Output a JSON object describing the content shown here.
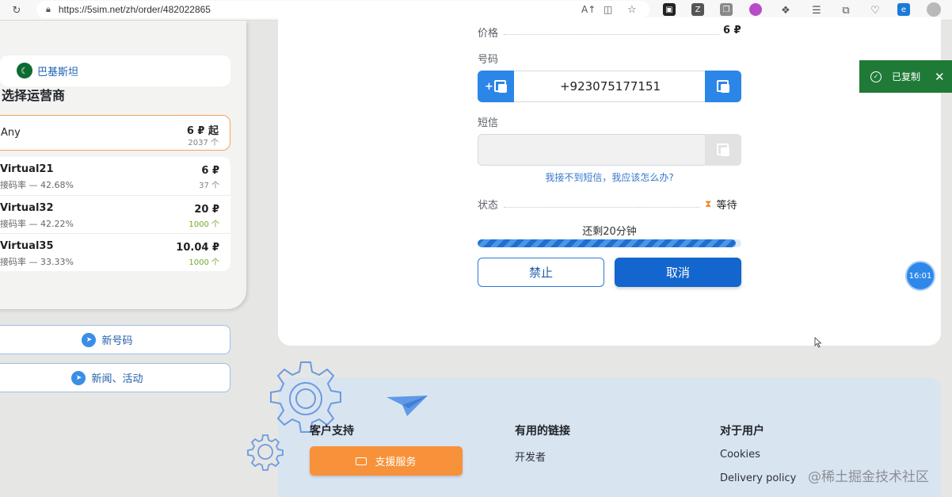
{
  "browser": {
    "url": "https://5sim.net/zh/order/482022865",
    "icons": [
      "refresh-icon",
      "lock-icon",
      "read-aloud-icon",
      "split-screen-icon",
      "favorite-add-icon",
      "favorites-icon",
      "collections-icon",
      "profile-avatar"
    ]
  },
  "sidebar": {
    "country": "巴基斯坦",
    "section_title": "选择运营商",
    "any": {
      "name": "Any",
      "price": "6 ₽ 起",
      "count": "2037 个"
    },
    "operators": [
      {
        "name": "Virtual21",
        "rate": "接码率 — 42.68%",
        "price": "6 ₽",
        "count": "37 个",
        "count_color": "#808080"
      },
      {
        "name": "Virtual32",
        "rate": "接码率 — 42.22%",
        "price": "20 ₽",
        "count": "1000 个",
        "count_color": "#74a82c"
      },
      {
        "name": "Virtual35",
        "rate": "接码率 — 33.33%",
        "price": "10.04 ₽",
        "count": "1000 个",
        "count_color": "#74a82c"
      }
    ],
    "links": {
      "new_number": "新号码",
      "news": "新闻、活动"
    }
  },
  "order": {
    "price_label": "价格",
    "price_value": "6 ₽",
    "number_label": "号码",
    "number_value": "+923075177151",
    "sms_label": "短信",
    "help_link": "我接不到短信，我应该怎么办?",
    "status_label": "状态",
    "status_value": "等待",
    "remaining": "还剩20分钟",
    "progress_fraction": 0.98,
    "ban_button": "禁止",
    "cancel_button": "取消"
  },
  "toast": {
    "text": "已复制"
  },
  "clock": {
    "time": "16:01"
  },
  "footer": {
    "support_title": "客户支持",
    "support_button": "支援服务",
    "links_title": "有用的链接",
    "links": [
      "开发者"
    ],
    "users_title": "对于用户",
    "user_links": [
      "Cookies",
      "Delivery policy"
    ]
  },
  "watermark": "@稀土掘金技术社区",
  "colors": {
    "primary": "#1366cd",
    "accent_blue": "#2b86e8",
    "orange": "#f7923a",
    "toast_green": "#1f7a38"
  }
}
